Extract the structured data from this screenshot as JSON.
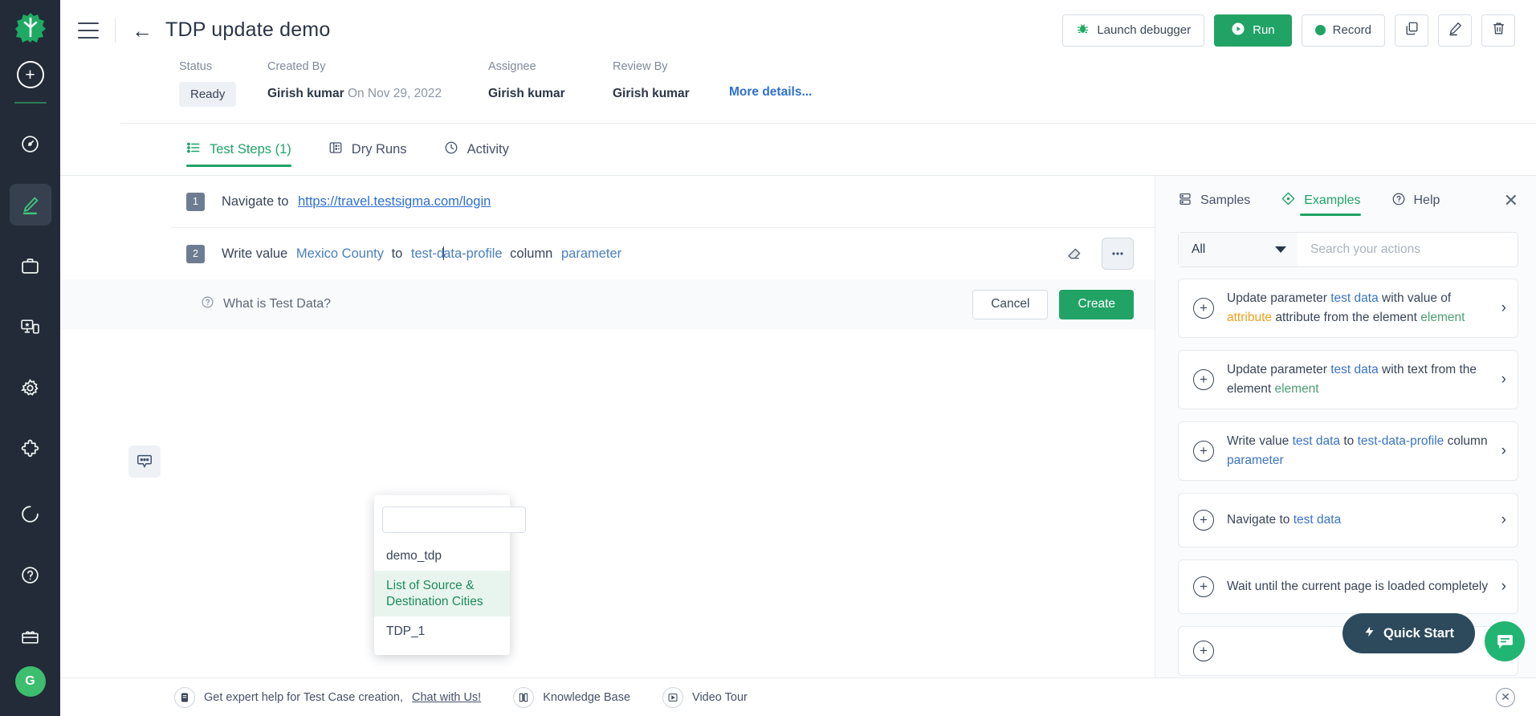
{
  "sidebar": {
    "logo_icon": "testsigma-logo-icon",
    "add_label": "+",
    "items": [
      {
        "icon": "speedometer-icon",
        "name": "dashboard",
        "active": false
      },
      {
        "icon": "pencil-edit-icon",
        "name": "test-development",
        "active": true
      },
      {
        "icon": "briefcase-icon",
        "name": "test-plans",
        "active": false
      },
      {
        "icon": "device-lab-icon",
        "name": "test-lab",
        "active": false
      },
      {
        "icon": "gear-icon",
        "name": "settings",
        "active": false
      },
      {
        "icon": "puzzle-icon",
        "name": "addons",
        "active": false
      }
    ],
    "bottom_items": [
      {
        "icon": "progress-circle-icon",
        "name": "usage"
      },
      {
        "icon": "question-circle-icon",
        "name": "help"
      },
      {
        "icon": "gift-icon",
        "name": "whats-new"
      }
    ],
    "avatar_initial": "G"
  },
  "header": {
    "title": "TDP update demo",
    "back_icon": "back-arrow-icon",
    "menu_icon": "hamburger-icon",
    "buttons": {
      "launch_debugger": "Launch debugger",
      "run": "Run",
      "record": "Record",
      "copy_icon": "copy-icon",
      "edit_icon": "pencil-icon",
      "delete_icon": "trash-icon"
    }
  },
  "meta": {
    "status_label": "Status",
    "status_value": "Ready",
    "created_by_label": "Created By",
    "created_by_name": "Girish kumar",
    "created_by_date": "On Nov 29, 2022",
    "assignee_label": "Assignee",
    "assignee_value": "Girish kumar",
    "review_by_label": "Review By",
    "review_by_value": "Girish kumar",
    "more_details": "More details..."
  },
  "tabs": [
    {
      "label": "Test Steps (1)",
      "icon": "list-icon",
      "active": true
    },
    {
      "label": "Dry Runs",
      "icon": "dry-run-icon",
      "active": false
    },
    {
      "label": "Activity",
      "icon": "clock-icon",
      "active": false
    }
  ],
  "steps": [
    {
      "number": "1",
      "prefix": "Navigate to",
      "link": "https://travel.testsigma.com/login",
      "mid": "",
      "suffix": ""
    },
    {
      "number": "2",
      "prefix": "Write value",
      "value": "Mexico County",
      "to": "to",
      "profile_a": "test-d",
      "profile_b": "ata-profile",
      "column": "column",
      "parameter": "parameter"
    }
  ],
  "step_tools": {
    "comment_icon": "comment-icon",
    "eraser_icon": "eraser-icon",
    "more_icon": "more-options-icon"
  },
  "test_data_bar": {
    "help_icon": "question-circle-icon",
    "question": "What is Test Data?",
    "cancel": "Cancel",
    "create": "Create"
  },
  "dropdown": {
    "search_value": "",
    "options": [
      {
        "label": "demo_tdp",
        "selected": false
      },
      {
        "label": "List of Source & Destination Cities",
        "selected": true
      },
      {
        "label": "TDP_1",
        "selected": false
      }
    ]
  },
  "right_panel": {
    "tabs": [
      {
        "label": "Samples",
        "icon": "samples-icon",
        "active": false
      },
      {
        "label": "Examples",
        "icon": "examples-diamond-icon",
        "active": true
      },
      {
        "label": "Help",
        "icon": "question-circle-icon",
        "active": false
      }
    ],
    "close_icon": "close-icon",
    "filter_value": "All",
    "search_placeholder": "Search your actions",
    "search_value": "",
    "examples": [
      {
        "parts": [
          {
            "t": "Update parameter",
            "c": "n"
          },
          {
            "t": "test data",
            "c": "b"
          },
          {
            "t": "with value of",
            "c": "n"
          },
          {
            "t": "attribute",
            "c": "o"
          },
          {
            "t": "attribute from the element",
            "c": "n"
          },
          {
            "t": "element",
            "c": "g"
          }
        ]
      },
      {
        "parts": [
          {
            "t": "Update parameter",
            "c": "n"
          },
          {
            "t": "test data",
            "c": "b"
          },
          {
            "t": "with text from the element",
            "c": "n"
          },
          {
            "t": "element",
            "c": "g"
          }
        ]
      },
      {
        "parts": [
          {
            "t": "Write value",
            "c": "n"
          },
          {
            "t": "test data",
            "c": "b"
          },
          {
            "t": "to",
            "c": "n"
          },
          {
            "t": "test-data-profile",
            "c": "b"
          },
          {
            "t": "column",
            "c": "n"
          },
          {
            "t": "parameter",
            "c": "b"
          }
        ]
      },
      {
        "parts": [
          {
            "t": "Navigate to",
            "c": "n"
          },
          {
            "t": "test data",
            "c": "b"
          }
        ]
      },
      {
        "parts": [
          {
            "t": "Wait until the current page is loaded completely",
            "c": "n"
          }
        ]
      }
    ]
  },
  "quick_start": {
    "label": "Quick Start",
    "icon": "lightning-icon"
  },
  "chat_fab": {
    "icon": "chat-bubble-icon"
  },
  "footer": {
    "help_text": "Get expert help for Test Case creation,",
    "chat_link": "Chat with Us!",
    "knowledge_base": "Knowledge Base",
    "video_tour": "Video Tour",
    "chat_icon": "chat-icon",
    "book_icon": "book-icon",
    "play_icon": "play-icon",
    "close_icon": "close-circle-icon"
  },
  "colors": {
    "accent_green": "#21a366",
    "link_blue": "#2f6fd0",
    "rail_bg": "#232B38"
  }
}
